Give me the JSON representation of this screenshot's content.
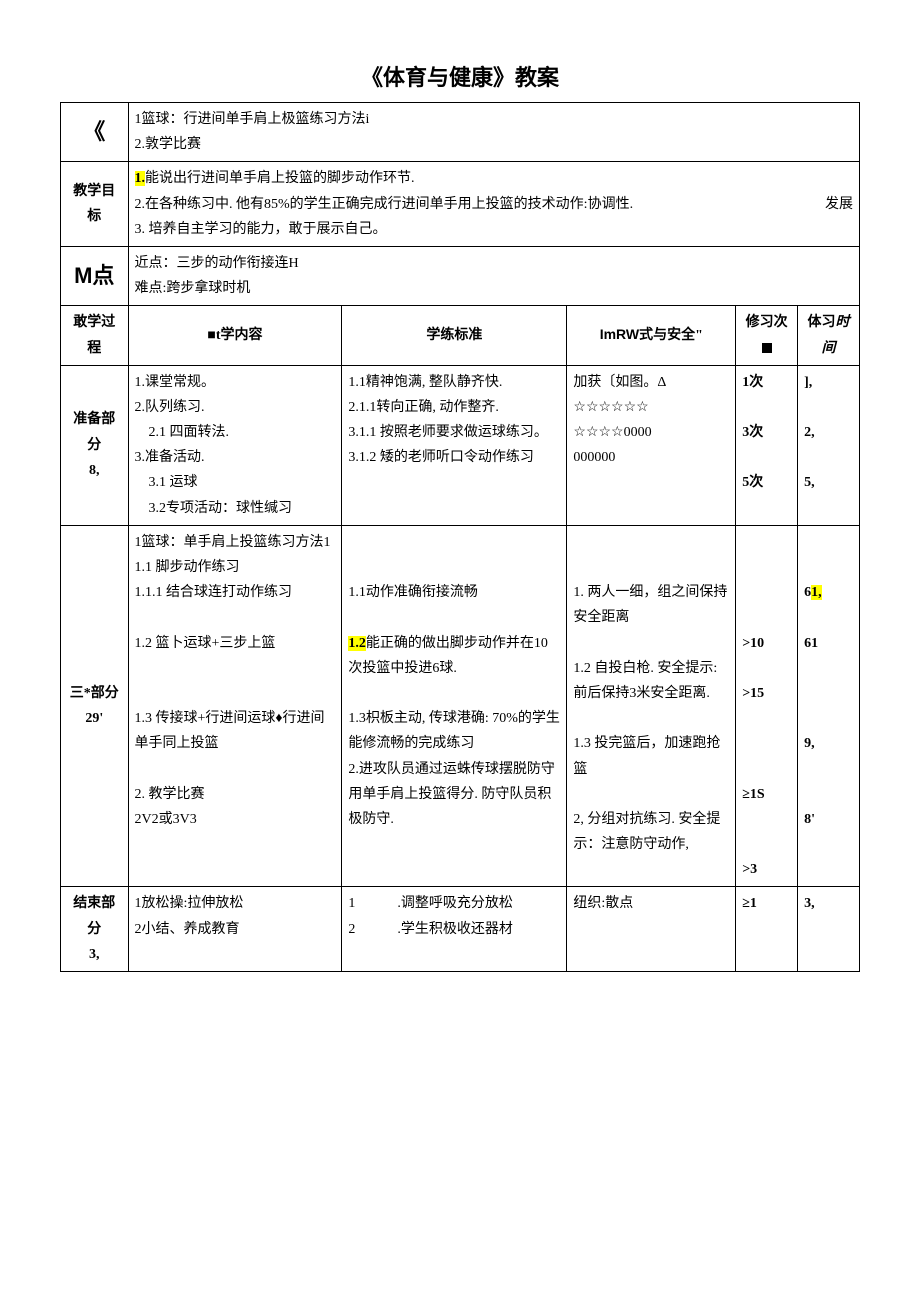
{
  "title": "《体育与健康》教案",
  "sections": {
    "row1": {
      "label": "《",
      "content": "1篮球：行进间单手肩上极篮练习方法i\n2.敦学比赛"
    },
    "row2": {
      "label": "教学目标",
      "p1_prefix": "1.",
      "p1": "能说出行进间单手肩上投篮的脚步动作环节.",
      "p2": "2.在各种练习中. 他有85%的学生正确完成行进间单手用上投篮的技术动作:协调性.",
      "p2_right": "发展",
      "p3": "3. 培养自主学习的能力，敢于展示自己。"
    },
    "row3": {
      "label": "M点",
      "content": "近点：三步的动作衔接连H\n难点:跨步拿球时机"
    }
  },
  "headers": {
    "process": "敢学过程",
    "content_pre": "■t",
    "content": "学内容",
    "standard": "学练标准",
    "org_pre": "ImRW",
    "org": "式与安全\"",
    "count": "修习次",
    "count_sq": "■",
    "time_pre": "体习",
    "time": "时间"
  },
  "prep": {
    "label": "准备部分\n8,",
    "content": "1.课堂常规。\n2.队列练习.\n　2.1 四面转法.\n3.准备活动.\n　3.1 运球\n　3.2专项活动：球性缄习",
    "standard": "1.1精神饱满, 整队静齐快.\n2.1.1转向正确, 动作整齐.\n3.1.1 按照老师要求做运球练习。\n3.1.2 矮的老师听口令动作练习",
    "org": "加获〔如图。Δ\n☆☆☆☆☆☆\n☆☆☆☆0000\n000000",
    "count": "1次\n\n3次\n\n5次",
    "time": "],\n\n2,\n\n5,"
  },
  "main": {
    "label": "三*部分29'",
    "content_1": "1篮球：单手肩上投篮练习方法1",
    "content_11": "1.1 脚步动作练习",
    "content_111": "1.1.1 结合球连打动作练习",
    "content_12": "1.2 篮卜运球+三步上篮",
    "content_13": "1.3 传接球+行进间运球♦行进间单手同上投篮",
    "content_2": "2. 教学比赛",
    "content_2b": "2V2或3V3",
    "standard_11": "1.1动作准确衔接流畅",
    "standard_12_pre": "1.2",
    "standard_12": "能正确的做出脚步动作并在10次投篮中投进6球.",
    "standard_13": "1.3枳板主动, 传球港确: 70%的学生能修流畅的完成练习",
    "standard_2": "2.进攻队员通过运蛛传球摆脱防守用单手肩上投篮得分. 防守队员积极防守.",
    "org_1": "1. 两人一细，组之间保持安全距离",
    "org_12": "1.2 自投白枪. 安全提示:前后保持3米安全距离.",
    "org_13": "1.3 投完篮后，加速跑抢篮",
    "org_2": "2, 分组对抗练习. 安全提示：注意防守动作,",
    "count": ">10\n\n>15\n\n\n\n≥1S\n\n\n>3",
    "time_1a": "6",
    "time_1b": "1,",
    "time_2": "61",
    "time_3": "9,",
    "time_4": "8'"
  },
  "end": {
    "label": "结束部分\n3,",
    "content": "1放松操:拉伸放松\n2小结、养成教育",
    "standard": "1　　　.调整呼吸充分放松\n2　　　.学生积极收还器材",
    "org": "纽织:散点",
    "count": "≥1",
    "time": "3,"
  }
}
